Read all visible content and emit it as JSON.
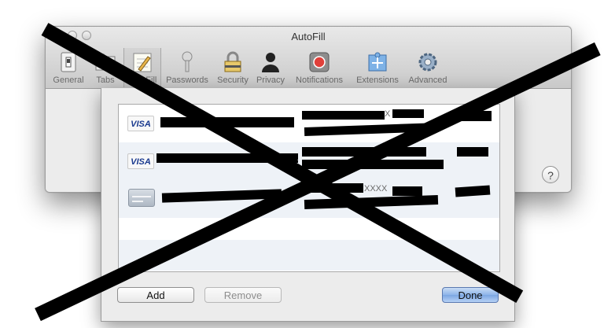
{
  "window": {
    "title": "AutoFill",
    "toolbar": [
      {
        "label": "General",
        "icon": "general-switch-icon"
      },
      {
        "label": "Tabs",
        "icon": "tabs-icon"
      },
      {
        "label": "AutoFill",
        "icon": "autofill-pencil-icon",
        "selected": true
      },
      {
        "label": "Passwords",
        "icon": "key-icon"
      },
      {
        "label": "Security",
        "icon": "lock-icon"
      },
      {
        "label": "Privacy",
        "icon": "person-silhouette-icon"
      },
      {
        "label": "Notifications",
        "icon": "notification-badge-icon"
      },
      {
        "label": "Extensions",
        "icon": "puzzle-icon"
      },
      {
        "label": "Advanced",
        "icon": "gear-icon"
      }
    ],
    "help_label": "?"
  },
  "sheet": {
    "cards": [
      {
        "type_label": "VISA",
        "icon": "visa-card-icon",
        "number_fragment": "X"
      },
      {
        "type_label": "VISA",
        "icon": "visa-card-icon",
        "number_fragment": "."
      },
      {
        "type_label": "",
        "icon": "generic-card-icon",
        "number_fragment": "XXXX"
      }
    ],
    "buttons": {
      "add": "Add",
      "remove": "Remove",
      "done": "Done"
    }
  },
  "colors": {
    "selection_accent": "#7ca6e2",
    "redaction": "#000000",
    "visa_text": "#1a3a8f"
  }
}
